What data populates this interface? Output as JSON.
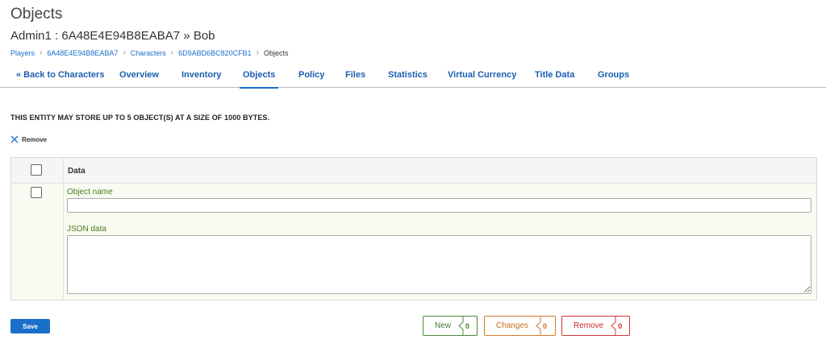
{
  "header": {
    "title": "Objects",
    "subtitle": "Admin1 : 6A48E4E94B8EABA7 » Bob"
  },
  "breadcrumb": {
    "items": [
      "Players",
      "6A48E4E94B8EABA7",
      "Characters",
      "6D9ABD6BC820CFB1"
    ],
    "current": "Objects"
  },
  "tabs": [
    {
      "label": "« Back to Characters"
    },
    {
      "label": "Overview"
    },
    {
      "label": "Inventory"
    },
    {
      "label": "Objects",
      "active": true
    },
    {
      "label": "Policy"
    },
    {
      "label": "Files"
    },
    {
      "label": "Statistics"
    },
    {
      "label": "Virtual Currency"
    },
    {
      "label": "Title Data"
    },
    {
      "label": "Groups"
    }
  ],
  "notice": "THIS ENTITY MAY STORE UP TO 5 OBJECT(S) AT A SIZE OF 1000 BYTES.",
  "toolbar": {
    "remove_label": "Remove"
  },
  "grid": {
    "column_header": "Data",
    "row": {
      "object_name_label": "Object name",
      "object_name_value": "",
      "json_data_label": "JSON data",
      "json_data_value": ""
    }
  },
  "footer": {
    "save_label": "Save",
    "new_label": "New",
    "new_count": "0",
    "changes_label": "Changes",
    "changes_count": "0",
    "remove_label": "Remove",
    "remove_count": "0"
  },
  "colors": {
    "accent": "#1a6fc9",
    "field_label": "#4c7a1f",
    "new": "#3d7d2d",
    "changes": "#c46c20",
    "remove": "#c82828"
  }
}
